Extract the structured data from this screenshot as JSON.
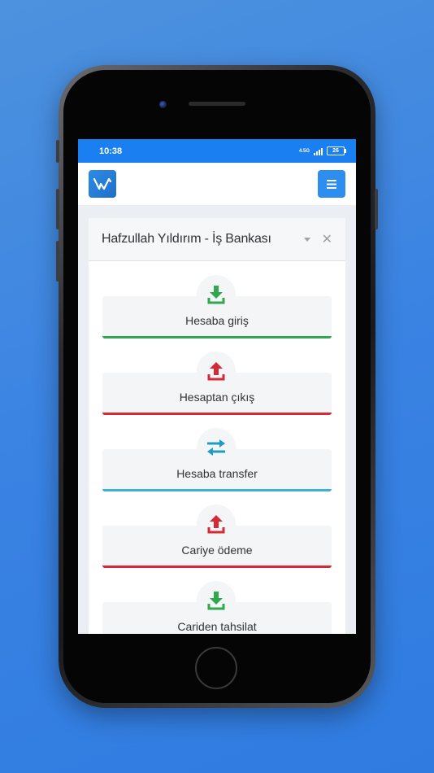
{
  "status_bar": {
    "time": "10:38",
    "network": "4.5G",
    "battery": "26"
  },
  "card": {
    "title": "Hafzullah Yıldırım - İş Bankası"
  },
  "actions": [
    {
      "label": "Hesaba giriş",
      "icon": "download-icon",
      "color": "#2fa84f"
    },
    {
      "label": "Hesaptan çıkış",
      "icon": "upload-icon",
      "color": "#d42a35"
    },
    {
      "label": "Hesaba transfer",
      "icon": "transfer-icon",
      "color": "#1f9cc4"
    },
    {
      "label": "Cariye ödeme",
      "icon": "upload-icon",
      "color": "#d42a35"
    },
    {
      "label": "Cariden tahsilat",
      "icon": "download-icon",
      "color": "#2fa84f"
    }
  ],
  "colors": {
    "primary": "#1a7ff0",
    "success": "#2fa84f",
    "danger": "#d42a35",
    "info": "#39b2d6"
  }
}
